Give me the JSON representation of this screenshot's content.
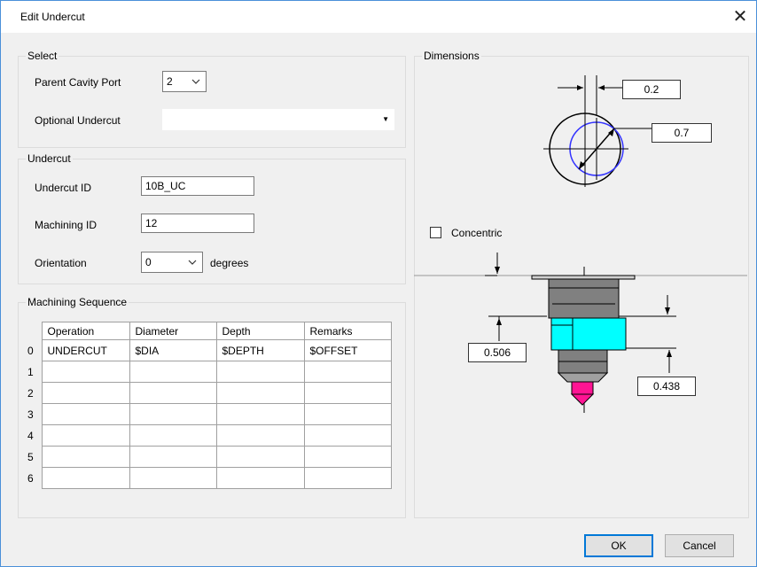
{
  "window": {
    "title": "Edit Undercut"
  },
  "select": {
    "group_label": "Select",
    "parent_cavity_port_label": "Parent Cavity Port",
    "parent_cavity_port_value": "2",
    "optional_undercut_label": "Optional Undercut",
    "optional_undercut_value": ""
  },
  "undercut": {
    "group_label": "Undercut",
    "undercut_id_label": "Undercut ID",
    "undercut_id_value": "10B_UC",
    "machining_id_label": "Machining ID",
    "machining_id_value": "12",
    "orientation_label": "Orientation",
    "orientation_value": "0",
    "orientation_unit": "degrees"
  },
  "sequence": {
    "group_label": "Machining Sequence",
    "columns": [
      "Operation",
      "Diameter",
      "Depth",
      "Remarks"
    ],
    "rows": [
      {
        "index": "0",
        "cells": [
          "UNDERCUT",
          "$DIA",
          "$DEPTH",
          "$OFFSET"
        ]
      },
      {
        "index": "1",
        "cells": [
          "",
          "",
          "",
          ""
        ]
      },
      {
        "index": "2",
        "cells": [
          "",
          "",
          "",
          ""
        ]
      },
      {
        "index": "3",
        "cells": [
          "",
          "",
          "",
          ""
        ]
      },
      {
        "index": "4",
        "cells": [
          "",
          "",
          "",
          ""
        ]
      },
      {
        "index": "5",
        "cells": [
          "",
          "",
          "",
          ""
        ]
      },
      {
        "index": "6",
        "cells": [
          "",
          "",
          "",
          ""
        ]
      }
    ]
  },
  "dimensions": {
    "group_label": "Dimensions",
    "offset_value": "0.2",
    "diameter_value": "0.7",
    "concentric_label": "Concentric",
    "concentric_checked": false,
    "depth_value": "0.506",
    "height_value": "0.438"
  },
  "buttons": {
    "ok": "OK",
    "cancel": "Cancel"
  },
  "colors": {
    "accent": "#0078d7",
    "cyan": "#00ffff",
    "magenta": "#ff1493",
    "gray": "#808080",
    "circle_blue": "#3333ff"
  }
}
